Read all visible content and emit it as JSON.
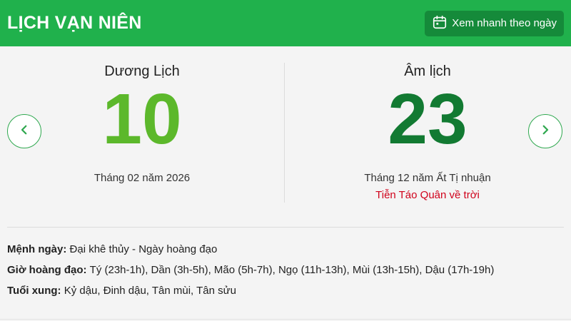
{
  "header": {
    "title": "LỊCH VẠN NIÊN",
    "quick_view_label": "Xem nhanh theo ngày",
    "quick_view_icon": "calendar-icon"
  },
  "colors": {
    "header_bg": "#20b14c",
    "button_bg": "#158a3a",
    "solar_day": "#5cb82b",
    "lunar_day": "#127a32",
    "festival": "#d0021b"
  },
  "solar": {
    "heading": "Dương Lịch",
    "day": "10",
    "month_year": "Tháng 02 năm 2026"
  },
  "lunar": {
    "heading": "Âm lịch",
    "day": "23",
    "month_year": "Tháng 12 năm Ất Tị nhuận",
    "festival": "Tiễn Táo Quân về trời"
  },
  "nav": {
    "prev_icon": "chevron-left-icon",
    "next_icon": "chevron-right-icon"
  },
  "details": {
    "menh_ngay": {
      "label": "Mệnh ngày:",
      "value": "Đại khê thủy - Ngày hoàng đạo"
    },
    "gio_hoang_dao": {
      "label": "Giờ hoàng đạo:",
      "value": "Tý (23h-1h), Dần (3h-5h), Mão (5h-7h), Ngọ (11h-13h), Mùi (13h-15h), Dậu (17h-19h)"
    },
    "tuoi_xung": {
      "label": "Tuổi xung:",
      "value": "Kỷ dậu, Đinh dậu, Tân mùi, Tân sửu"
    }
  }
}
